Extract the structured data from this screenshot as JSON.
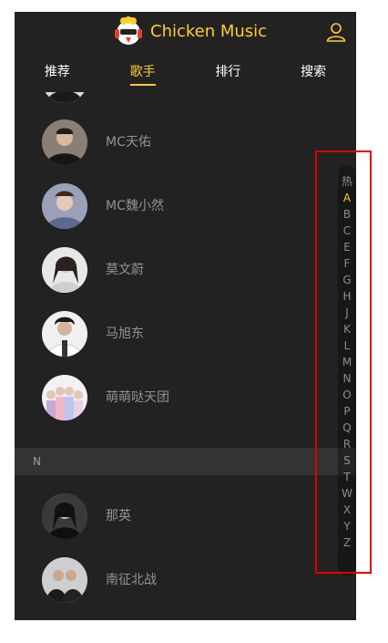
{
  "header": {
    "title": "Chicken Music"
  },
  "tabs": [
    {
      "label": "推荐",
      "active": false
    },
    {
      "label": "歌手",
      "active": true
    },
    {
      "label": "排行",
      "active": false
    },
    {
      "label": "搜索",
      "active": false
    }
  ],
  "singers_group_m": [
    {
      "name": "MC天佑"
    },
    {
      "name": "MC魏小然"
    },
    {
      "name": "莫文蔚"
    },
    {
      "name": "马旭东"
    },
    {
      "name": "萌萌哒天团"
    }
  ],
  "group_n": {
    "title": "N",
    "singers": [
      {
        "name": "那英"
      },
      {
        "name": "南征北战"
      }
    ]
  },
  "shortcut": {
    "items": [
      "热",
      "A",
      "B",
      "C",
      "E",
      "F",
      "G",
      "H",
      "J",
      "K",
      "L",
      "M",
      "N",
      "O",
      "P",
      "Q",
      "R",
      "S",
      "T",
      "W",
      "X",
      "Y",
      "Z"
    ],
    "active_index": 1
  },
  "colors": {
    "accent": "#ffcd32",
    "background": "#222222",
    "group_bg": "#333333",
    "highlight": "#e00000"
  },
  "icons": {
    "logo": "chicken-logo-icon",
    "user": "user-icon"
  }
}
